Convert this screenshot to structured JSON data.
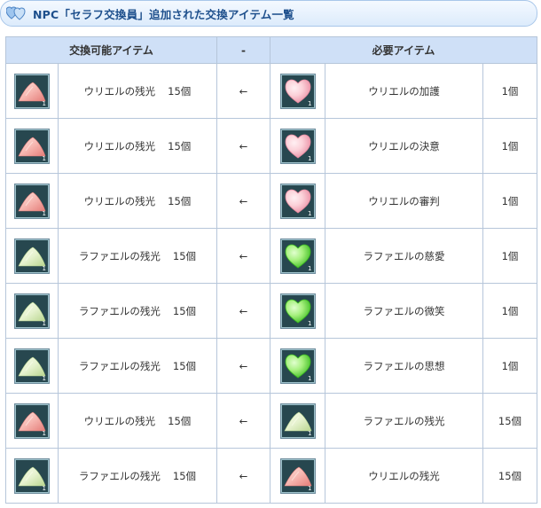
{
  "title": "NPC「セラフ交換員」追加された交換アイテム一覧",
  "colors": {
    "accent": "#1d4f8c",
    "header_bg": "#cfe0f7",
    "border": "#b6c6da",
    "uriel": "#e88a8a",
    "raphael": "#c7e0a6",
    "heart_pink": "#f0a0b0",
    "heart_green": "#5ed838"
  },
  "headers": {
    "exchangeable": "交換可能アイテム",
    "arrow": "-",
    "required": "必要アイテム"
  },
  "rows": [
    {
      "left_icon": "pink-pile-icon",
      "left_name": "ウリエルの残光",
      "left_qty": "15個",
      "arrow": "←",
      "right_icon": "pink-heart-icon",
      "right_name": "ウリエルの加護",
      "right_qty": "1個"
    },
    {
      "left_icon": "pink-pile-icon",
      "left_name": "ウリエルの残光",
      "left_qty": "15個",
      "arrow": "←",
      "right_icon": "pink-heart-icon",
      "right_name": "ウリエルの決意",
      "right_qty": "1個"
    },
    {
      "left_icon": "pink-pile-icon",
      "left_name": "ウリエルの残光",
      "left_qty": "15個",
      "arrow": "←",
      "right_icon": "pink-heart-icon",
      "right_name": "ウリエルの審判",
      "right_qty": "1個"
    },
    {
      "left_icon": "green-pile-icon",
      "left_name": "ラファエルの残光",
      "left_qty": "15個",
      "arrow": "←",
      "right_icon": "green-heart-icon",
      "right_name": "ラファエルの慈愛",
      "right_qty": "1個"
    },
    {
      "left_icon": "green-pile-icon",
      "left_name": "ラファエルの残光",
      "left_qty": "15個",
      "arrow": "←",
      "right_icon": "green-heart-icon",
      "right_name": "ラファエルの微笑",
      "right_qty": "1個"
    },
    {
      "left_icon": "green-pile-icon",
      "left_name": "ラファエルの残光",
      "left_qty": "15個",
      "arrow": "←",
      "right_icon": "green-heart-icon",
      "right_name": "ラファエルの思想",
      "right_qty": "1個"
    },
    {
      "left_icon": "pink-pile-icon",
      "left_name": "ウリエルの残光",
      "left_qty": "15個",
      "arrow": "←",
      "right_icon": "green-pile-icon",
      "right_name": "ラファエルの残光",
      "right_qty": "15個"
    },
    {
      "left_icon": "green-pile-icon",
      "left_name": "ラファエルの残光",
      "left_qty": "15個",
      "arrow": "←",
      "right_icon": "pink-pile-icon",
      "right_name": "ウリエルの残光",
      "right_qty": "15個"
    }
  ],
  "icon_count_label": "1"
}
